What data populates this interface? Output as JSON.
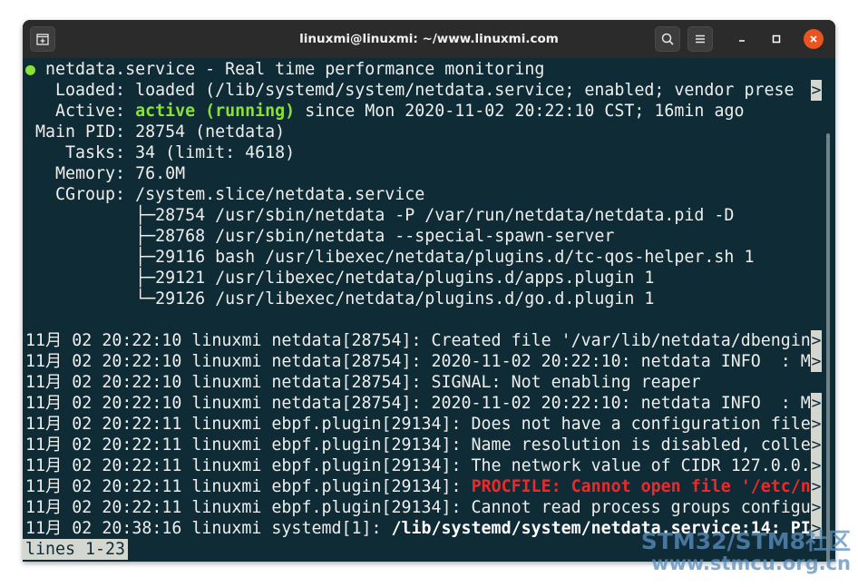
{
  "window": {
    "title": "linuxmi@linuxmi: ~/www.linuxmi.com",
    "icons": {
      "new_tab": "new-tab-icon",
      "search": "search-icon",
      "menu": "hamburger-menu-icon",
      "minimize": "minimize-icon",
      "maximize": "maximize-icon",
      "close": "close-icon"
    },
    "close_color": "#e95420"
  },
  "terminal": {
    "colors": {
      "background": "#0f2b36",
      "foreground": "#eeeeec",
      "green": "#8ae234",
      "red": "#ef2929"
    },
    "service_header": {
      "bullet": "●",
      "text": "netdata.service - Real time performance monitoring"
    },
    "loaded": {
      "label": "   Loaded:",
      "value": " loaded (/lib/systemd/system/netdata.service; enabled; vendor prese"
    },
    "active": {
      "label": "   Active:",
      "status": "active (running)",
      "rest": " since Mon 2020-11-02 20:22:10 CST; 16min ago"
    },
    "main_pid": {
      "label": " Main PID:",
      "value": " 28754 (netdata)"
    },
    "tasks": {
      "label": "    Tasks:",
      "value": " 34 (limit: 4618)"
    },
    "memory": {
      "label": "   Memory:",
      "value": " 76.0M"
    },
    "cgroup": {
      "label": "   CGroup:",
      "value": " /system.slice/netdata.service"
    },
    "cgroup_tree": [
      "           ├─28754 /usr/sbin/netdata -P /var/run/netdata/netdata.pid -D",
      "           ├─28768 /usr/sbin/netdata --special-spawn-server",
      "           ├─29116 bash /usr/libexec/netdata/plugins.d/tc-qos-helper.sh 1",
      "           ├─29121 /usr/libexec/netdata/plugins.d/apps.plugin 1",
      "           └─29126 /usr/libexec/netdata/plugins.d/go.d.plugin 1"
    ],
    "log_lines": [
      {
        "text": "11月 02 20:22:10 linuxmi netdata[28754]: Created file '/var/lib/netdata/dbengin",
        "truncated": true
      },
      {
        "text": "11月 02 20:22:10 linuxmi netdata[28754]: 2020-11-02 20:22:10: netdata INFO  : M",
        "truncated": true
      },
      {
        "text": "11月 02 20:22:10 linuxmi netdata[28754]: SIGNAL: Not enabling reaper",
        "truncated": false
      },
      {
        "text": "11月 02 20:22:10 linuxmi netdata[28754]: 2020-11-02 20:22:10: netdata INFO  : M",
        "truncated": true
      },
      {
        "text": "11月 02 20:22:11 linuxmi ebpf.plugin[29134]: Does not have a configuration file",
        "truncated": true
      },
      {
        "text": "11月 02 20:22:11 linuxmi ebpf.plugin[29134]: Name resolution is disabled, colle",
        "truncated": true
      },
      {
        "text": "11月 02 20:22:11 linuxmi ebpf.plugin[29134]: The network value of CIDR 127.0.0.",
        "truncated": true
      },
      {
        "prefix": "11月 02 20:22:11 linuxmi ebpf.plugin[29134]: ",
        "red": "PROCFILE: Cannot open file '/etc/n",
        "truncated": true
      },
      {
        "text": "11月 02 20:22:11 linuxmi ebpf.plugin[29134]: Cannot read process groups configu",
        "truncated": true
      },
      {
        "prefix": "11月 02 20:38:16 linuxmi systemd[1]: ",
        "bold": "/lib/systemd/system/netdata.service:14: PI",
        "truncated": true
      }
    ],
    "truncation_marker": ">",
    "status_line": "lines 1-23"
  },
  "watermark": {
    "line1": "STM32/STM8社区",
    "line2": "www.stmcu.org.cn"
  }
}
